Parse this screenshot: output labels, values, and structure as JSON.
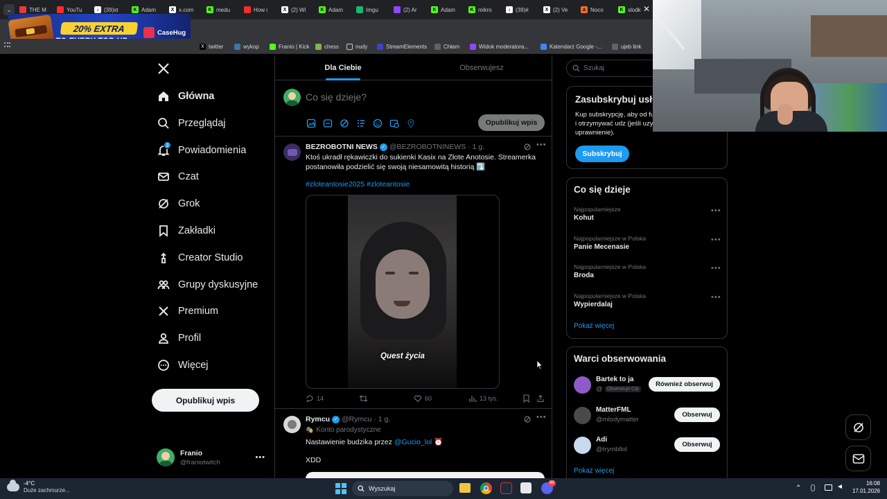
{
  "browser": {
    "tabs": [
      {
        "label": "THE M",
        "fav": "#e23b3b",
        "ch": ""
      },
      {
        "label": "YouTu",
        "fav": "#ff2b2b",
        "ch": ""
      },
      {
        "label": "(39)st",
        "fav": "#ffffff",
        "ch": "♪"
      },
      {
        "label": "Adam",
        "fav": "#53fc18",
        "ch": "K"
      },
      {
        "label": "x.com",
        "fav": "#ffffff",
        "ch": "X"
      },
      {
        "label": "medu",
        "fav": "#53fc18",
        "ch": "K"
      },
      {
        "label": "How i",
        "fav": "#ff2b2b",
        "ch": ""
      },
      {
        "label": "(2) Wi",
        "fav": "#ffffff",
        "ch": "X"
      },
      {
        "label": "Adam",
        "fav": "#53fc18",
        "ch": "K"
      },
      {
        "label": "Imgu",
        "fav": "#1bb76e",
        "ch": ""
      },
      {
        "label": "(2) Ar",
        "fav": "#9146ff",
        "ch": ""
      },
      {
        "label": "Adam",
        "fav": "#53fc18",
        "ch": "K"
      },
      {
        "label": "mikro",
        "fav": "#53fc18",
        "ch": "K"
      },
      {
        "label": "(39)#",
        "fav": "#ffffff",
        "ch": "♪"
      },
      {
        "label": "(2) Ve",
        "fav": "#ffffff",
        "ch": "X"
      },
      {
        "label": "Noco",
        "fav": "#ff6a2b",
        "ch": "a"
      },
      {
        "label": "slodk",
        "fav": "#53fc18",
        "ch": "K"
      }
    ],
    "bookmarks": [
      {
        "label": "twitter",
        "icon": "x-icon"
      },
      {
        "label": "wykop",
        "icon": "wykop-icon"
      },
      {
        "label": "Franio | Kick",
        "icon": "kick-icon"
      },
      {
        "label": "chess",
        "icon": "chess-icon"
      },
      {
        "label": "nudy",
        "icon": "folder-icon"
      },
      {
        "label": "StreamElements",
        "icon": "streamelements-icon"
      },
      {
        "label": "Chłam",
        "icon": "globe-icon"
      },
      {
        "label": "Widok moderatora...",
        "icon": "twitch-icon"
      },
      {
        "label": "Kalendarz Google -...",
        "icon": "calendar-icon"
      },
      {
        "label": "ujeb link",
        "icon": "globe-icon"
      }
    ]
  },
  "ad": {
    "line1": "20% EXTRA",
    "line2": "TO EVERY TOP-UP",
    "brand": "CaseHug"
  },
  "nav": {
    "items": [
      {
        "label": "Główna",
        "icon": "home-icon",
        "bold": true
      },
      {
        "label": "Przeglądaj",
        "icon": "search-icon"
      },
      {
        "label": "Powiadomienia",
        "icon": "bell-icon",
        "badge": "2"
      },
      {
        "label": "Czat",
        "icon": "mail-icon"
      },
      {
        "label": "Grok",
        "icon": "grok-icon"
      },
      {
        "label": "Zakładki",
        "icon": "bookmark-icon"
      },
      {
        "label": "Creator Studio",
        "icon": "creator-icon"
      },
      {
        "label": "Grupy dyskusyjne",
        "icon": "communities-icon"
      },
      {
        "label": "Premium",
        "icon": "x-premium-icon"
      },
      {
        "label": "Profil",
        "icon": "profile-icon"
      },
      {
        "label": "Więcej",
        "icon": "more-circle-icon"
      }
    ],
    "post_button": "Opublikuj wpis",
    "account": {
      "name": "Franio",
      "handle": "@franiotwitch"
    }
  },
  "feed": {
    "tabs": [
      {
        "label": "Dla Ciebie",
        "active": true
      },
      {
        "label": "Obserwujesz",
        "active": false
      }
    ],
    "composer": {
      "placeholder": "Co się dzieje?",
      "publish": "Opublikuj wpis"
    },
    "posts": [
      {
        "name": "BEZROBOTNI NEWS",
        "handle": "@BEZROBOTNINEWS",
        "time": "· 1 g.",
        "text": "Ktoś ukradł rękawiczki do sukienki Kasix na Złote Anotosie. Streamerka postanowiła podzielić się swoją niesamowitą historią ⤵️",
        "hashtags": "#zloteantosie2025 #zloteantosie",
        "video_caption": "Quest życia",
        "replies": "14",
        "retweets": "",
        "likes": "60",
        "views": "13 tys."
      },
      {
        "name": "Rymcu",
        "handle": "@Rymcu",
        "time": "· 1 g.",
        "badge": "Konto parodystyczne",
        "text_before": "Nastawienie budzika przez ",
        "mention": "@Gucio_lol",
        "emoji": "⏰",
        "text2": "XDD"
      }
    ]
  },
  "sidebar": {
    "search_placeholder": "Szukaj",
    "subscribe": {
      "title": "Zasubskrybuj usłu",
      "text": "Kup subskrypcję, aby od funkcje i otrzymywać udz (jeśli uzyskasz uprawnienie).",
      "button": "Subskrybuj"
    },
    "trends_title": "Co się dzieje",
    "trends": [
      {
        "category": "Najpopularniejsze",
        "name": "Kohut"
      },
      {
        "category": "Najpopularniejsze w Polska",
        "name": "Panie Mecenasie"
      },
      {
        "category": "Najpopularniejsze w Polska",
        "name": "Broda"
      },
      {
        "category": "Najpopularniejsze w Polska",
        "name": "Wypierdalaj"
      }
    ],
    "show_more": "Pokaż więcej",
    "follow_title": "Warci obserwowania",
    "follow": [
      {
        "name": "Bartek to ja",
        "handle": "@",
        "tag": "Obserwuje Cię",
        "button": "Również obserwuj"
      },
      {
        "name": "MatterFML",
        "handle": "@mlodymatter",
        "button": "Obserwuj"
      },
      {
        "name": "Adi",
        "handle": "@trymbllol",
        "button": "Obserwuj"
      }
    ],
    "follow_more": "Pokaż więcej"
  },
  "taskbar": {
    "weather": {
      "temp": "-4°C",
      "desc": "Duże zachmurze..."
    },
    "search": "Wyszukaj",
    "time": "16:08",
    "date": "17.01.2026",
    "discord_badge": "99"
  },
  "colors": {
    "accent": "#1d9bf0",
    "bg": "#000000",
    "border": "#2f3336",
    "muted": "#71767b",
    "kick": "#53fc18"
  }
}
